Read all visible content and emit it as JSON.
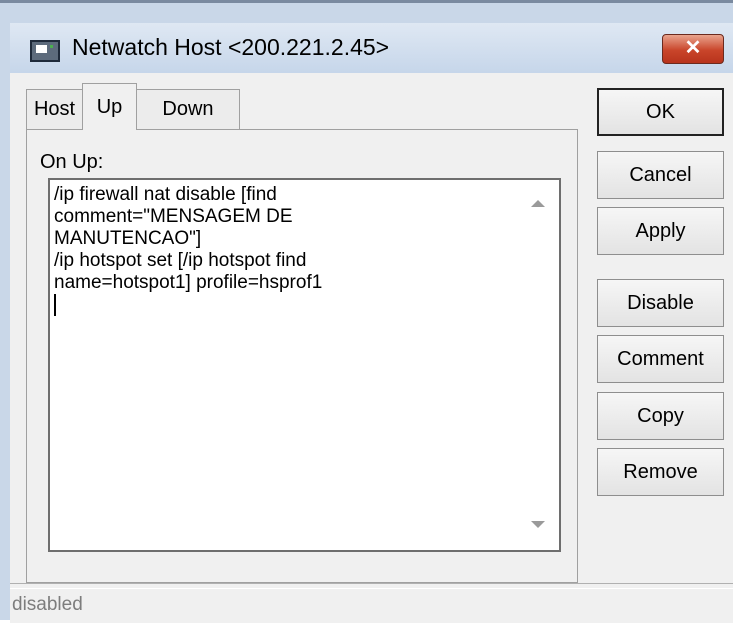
{
  "window": {
    "title": "Netwatch Host <200.221.2.45>",
    "close_label": "✕"
  },
  "tabs": [
    {
      "label": "Host",
      "active": false
    },
    {
      "label": "Up",
      "active": true
    },
    {
      "label": "Down",
      "active": false
    }
  ],
  "on_up": {
    "label": "On Up:",
    "script": "/ip firewall nat disable [find\ncomment=\"MENSAGEM DE\nMANUTENCAO\"]\n/ip hotspot set [/ip hotspot find\nname=hotspot1] profile=hsprof1\n"
  },
  "buttons": {
    "ok": "OK",
    "cancel": "Cancel",
    "apply": "Apply",
    "disable": "Disable",
    "comment": "Comment",
    "copy": "Copy",
    "remove": "Remove"
  },
  "status": {
    "text": "disabled"
  },
  "colors": {
    "close_button": "#c9452a",
    "window_frame": "#c9d7e8",
    "status_text": "#7d7d7d"
  }
}
